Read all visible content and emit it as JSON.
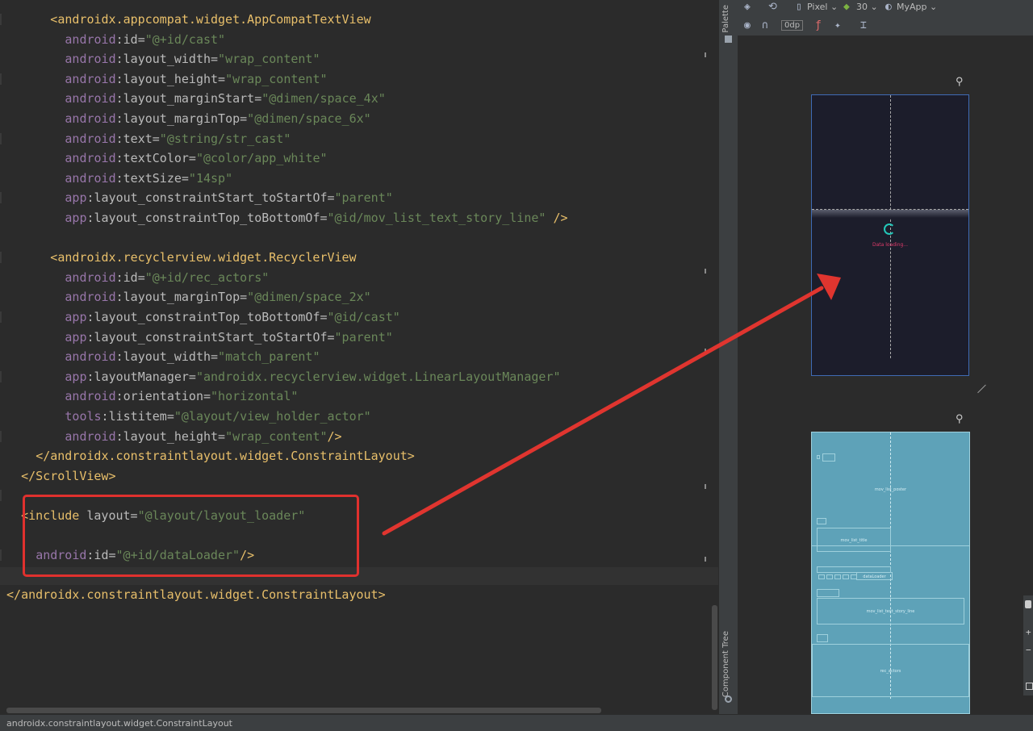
{
  "editor": {
    "lines": [
      {
        "indent": 6,
        "parts": [
          [
            "punct",
            "<"
          ],
          [
            "tag",
            "androidx.appcompat.widget.AppCompatTextView"
          ]
        ]
      },
      {
        "indent": 8,
        "parts": [
          [
            "ns",
            "android"
          ],
          [
            "attr",
            ":id="
          ],
          [
            "val",
            "\"@+id/cast\""
          ]
        ]
      },
      {
        "indent": 8,
        "parts": [
          [
            "ns",
            "android"
          ],
          [
            "attr",
            ":layout_width="
          ],
          [
            "val",
            "\"wrap_content\""
          ]
        ]
      },
      {
        "indent": 8,
        "parts": [
          [
            "ns",
            "android"
          ],
          [
            "attr",
            ":layout_height="
          ],
          [
            "val",
            "\"wrap_content\""
          ]
        ]
      },
      {
        "indent": 8,
        "parts": [
          [
            "ns",
            "android"
          ],
          [
            "attr",
            ":layout_marginStart="
          ],
          [
            "val",
            "\"@dimen/space_4x\""
          ]
        ]
      },
      {
        "indent": 8,
        "parts": [
          [
            "ns",
            "android"
          ],
          [
            "attr",
            ":layout_marginTop="
          ],
          [
            "val",
            "\"@dimen/space_6x\""
          ]
        ]
      },
      {
        "indent": 8,
        "parts": [
          [
            "ns",
            "android"
          ],
          [
            "attr",
            ":text="
          ],
          [
            "val",
            "\"@string/str_cast\""
          ]
        ]
      },
      {
        "indent": 8,
        "parts": [
          [
            "ns",
            "android"
          ],
          [
            "attr",
            ":textColor="
          ],
          [
            "val",
            "\"@color/app_white\""
          ]
        ]
      },
      {
        "indent": 8,
        "parts": [
          [
            "ns",
            "android"
          ],
          [
            "attr",
            ":textSize="
          ],
          [
            "val",
            "\"14sp\""
          ]
        ]
      },
      {
        "indent": 8,
        "parts": [
          [
            "ns",
            "app"
          ],
          [
            "attr",
            ":layout_constraintStart_toStartOf="
          ],
          [
            "val",
            "\"parent\""
          ]
        ]
      },
      {
        "indent": 8,
        "parts": [
          [
            "ns",
            "app"
          ],
          [
            "attr",
            ":layout_constraintTop_toBottomOf="
          ],
          [
            "val",
            "\"@id/mov_list_text_story_line\""
          ],
          [
            "punct",
            " />"
          ]
        ]
      },
      {
        "indent": 0,
        "parts": []
      },
      {
        "indent": 6,
        "parts": [
          [
            "punct",
            "<"
          ],
          [
            "tag",
            "androidx.recyclerview.widget.RecyclerView"
          ]
        ]
      },
      {
        "indent": 8,
        "parts": [
          [
            "ns",
            "android"
          ],
          [
            "attr",
            ":id="
          ],
          [
            "val",
            "\"@+id/rec_actors\""
          ]
        ]
      },
      {
        "indent": 8,
        "parts": [
          [
            "ns",
            "android"
          ],
          [
            "attr",
            ":layout_marginTop="
          ],
          [
            "val",
            "\"@dimen/space_2x\""
          ]
        ]
      },
      {
        "indent": 8,
        "parts": [
          [
            "ns",
            "app"
          ],
          [
            "attr",
            ":layout_constraintTop_toBottomOf="
          ],
          [
            "val",
            "\"@id/cast\""
          ]
        ]
      },
      {
        "indent": 8,
        "parts": [
          [
            "ns",
            "app"
          ],
          [
            "attr",
            ":layout_constraintStart_toStartOf="
          ],
          [
            "val",
            "\"parent\""
          ]
        ]
      },
      {
        "indent": 8,
        "parts": [
          [
            "ns",
            "android"
          ],
          [
            "attr",
            ":layout_width="
          ],
          [
            "val",
            "\"match_parent\""
          ]
        ]
      },
      {
        "indent": 8,
        "parts": [
          [
            "ns",
            "app"
          ],
          [
            "attr",
            ":layoutManager="
          ],
          [
            "val",
            "\"androidx.recyclerview.widget.LinearLayoutManager\""
          ]
        ]
      },
      {
        "indent": 8,
        "parts": [
          [
            "ns",
            "android"
          ],
          [
            "attr",
            ":orientation="
          ],
          [
            "val",
            "\"horizontal\""
          ]
        ]
      },
      {
        "indent": 8,
        "parts": [
          [
            "ns",
            "tools"
          ],
          [
            "attr",
            ":listitem="
          ],
          [
            "val",
            "\"@layout/view_holder_actor\""
          ]
        ]
      },
      {
        "indent": 8,
        "parts": [
          [
            "ns",
            "android"
          ],
          [
            "attr",
            ":layout_height="
          ],
          [
            "val",
            "\"wrap_content\""
          ],
          [
            "punct",
            "/>"
          ]
        ]
      },
      {
        "indent": 4,
        "parts": [
          [
            "punct",
            "</"
          ],
          [
            "tag",
            "androidx.constraintlayout.widget.ConstraintLayout"
          ],
          [
            "punct",
            ">"
          ]
        ]
      },
      {
        "indent": 2,
        "parts": [
          [
            "punct",
            "</"
          ],
          [
            "tag",
            "ScrollView"
          ],
          [
            "punct",
            ">"
          ]
        ]
      },
      {
        "indent": 0,
        "parts": []
      },
      {
        "indent": 2,
        "parts": [
          [
            "punct",
            "<"
          ],
          [
            "tag",
            "include "
          ],
          [
            "attr",
            "layout="
          ],
          [
            "val",
            "\"@layout/layout_loader\""
          ]
        ]
      },
      {
        "indent": 0,
        "parts": []
      },
      {
        "indent": 4,
        "parts": [
          [
            "ns",
            "android"
          ],
          [
            "attr",
            ":id="
          ],
          [
            "val",
            "\"@+id/dataLoader\""
          ],
          [
            "punct",
            "/>"
          ]
        ]
      },
      {
        "indent": 0,
        "parts": []
      },
      {
        "indent": 0,
        "parts": [
          [
            "punct",
            "</"
          ],
          [
            "tag",
            "androidx.constraintlayout.widget.ConstraintLayout"
          ],
          [
            "punct",
            ">"
          ]
        ]
      }
    ]
  },
  "side_panel": {
    "palette_label": "Palette",
    "component_tree_label": "Component Tree"
  },
  "toolbar": {
    "device_label": "Pixel ⌄",
    "api_label": "30 ⌄",
    "theme_label": "MyApp ⌄",
    "margin_label": "0dp"
  },
  "preview": {
    "loading_text": "Data loading...",
    "blueprint_labels": {
      "poster": "mov_list_poster",
      "title": "mov_list_title",
      "storyline": "mov_list_text_story_line",
      "actors": "rec_actors",
      "loader": "dataLoader"
    }
  },
  "status_bar": {
    "breadcrumb": "androidx.constraintlayout.widget.ConstraintLayout"
  },
  "colors": {
    "highlight": "#e0312e",
    "arrow": "#e0352f",
    "spinner": "#23c7b8",
    "loading_text": "#e03a6a"
  }
}
